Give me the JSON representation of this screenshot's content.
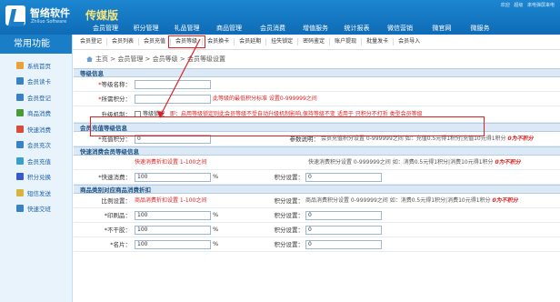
{
  "header": {
    "logo_cn": "智络软件",
    "logo_en": "Zhiluo Software",
    "version": "传媒版",
    "top_links": [
      "欢迎",
      "超级",
      "來电弹屏来电"
    ]
  },
  "main_nav": [
    {
      "label": "会员管理",
      "active": true
    },
    {
      "label": "积分管理",
      "active": false
    },
    {
      "label": "礼品管理",
      "active": false
    },
    {
      "label": "商品管理",
      "active": false
    },
    {
      "label": "会员消费",
      "active": false
    },
    {
      "label": "增值服务",
      "active": false
    },
    {
      "label": "统计报表",
      "active": false
    },
    {
      "label": "微信营销",
      "active": false
    },
    {
      "label": "微官网",
      "active": false
    },
    {
      "label": "微服务",
      "active": false
    }
  ],
  "sub_nav": [
    {
      "label": "会员登记",
      "active": false
    },
    {
      "label": "会员列表",
      "active": false
    },
    {
      "label": "会员充值",
      "active": false
    },
    {
      "label": "会员等级",
      "active": true
    },
    {
      "label": "会员换卡",
      "active": false
    },
    {
      "label": "会员延期",
      "active": false
    },
    {
      "label": "挂失锁定",
      "active": false
    },
    {
      "label": "密码鉴定",
      "active": false
    },
    {
      "label": "账户提现",
      "active": false
    },
    {
      "label": "批量发卡",
      "active": false
    },
    {
      "label": "会员导入",
      "active": false
    }
  ],
  "sidebar": {
    "title": "常用功能",
    "items": [
      {
        "label": "系统首页",
        "icon": "home-icon",
        "color": "#e8a23a"
      },
      {
        "label": "会员读卡",
        "icon": "read-card-icon",
        "color": "#3a82c8"
      },
      {
        "label": "会员登记",
        "icon": "register-icon",
        "color": "#3a82c8"
      },
      {
        "label": "商品消费",
        "icon": "cart-icon",
        "color": "#4a9a3a"
      },
      {
        "label": "快速消费",
        "icon": "quick-consume-icon",
        "color": "#d84a3a"
      },
      {
        "label": "会员充次",
        "icon": "recharge-times-icon",
        "color": "#3a82c8"
      },
      {
        "label": "会员充值",
        "icon": "recharge-icon",
        "color": "#3aa0c8"
      },
      {
        "label": "积分兑换",
        "icon": "points-exchange-icon",
        "color": "#3a5ac8"
      },
      {
        "label": "短信发送",
        "icon": "sms-icon",
        "color": "#d8b43a"
      },
      {
        "label": "快速交班",
        "icon": "handover-icon",
        "color": "#3a82c8"
      }
    ]
  },
  "breadcrumb": "主页 > 会员管理 > 会员等级 > 会员等级设置",
  "sections": {
    "level_info": "等级信息",
    "member_recharge": "会员充值等级信息",
    "quick_consume": "快速消费会员等级信息",
    "product_discount": "商品类别对应商品消费折扣"
  },
  "form": {
    "level_name": {
      "label": "等级名称：",
      "value": ""
    },
    "required_points": {
      "label": "所需积分：",
      "value": "",
      "hint": "此等级的最低积分标准 设置0-999999之间"
    },
    "upgrade_mechanism": {
      "label": "升级机制：",
      "checkbox_label": "等级锁定",
      "hint": "即：启用等级锁定则此会员等级不受自动升级机制影响,保持等级不变 适用于 只积分不打折 类型会员等级"
    },
    "recharge_points": {
      "label": "*充值积分：",
      "value": "0"
    },
    "param_desc": {
      "label": "参数说明：",
      "text": "会员充值积分设置 0-999999之间 如：充值0.5元得1积分|充值10元得1积分",
      "emph": "0为不积分"
    },
    "quick_discount_hint": "快速消费折扣设置 1-100之间",
    "quick_points_hint": "快速消费积分设置 0-999999之间 如：消费0.5元得1积分|消费10元得1积分",
    "quick_points_emph": "0为不积分",
    "quick_consume": {
      "label": "*快速消费：",
      "value": "100",
      "unit": "%"
    },
    "quick_points": {
      "label": "积分设置：",
      "value": "0"
    },
    "ratio": {
      "label": "比例设置：",
      "hint": "商品消费折扣设置 1-100之间"
    },
    "ratio_points": {
      "label": "积分设置：",
      "hint": "商品消费积分设置 0-999999之间 如：消费0.5元得1积分|消费10元得1积分",
      "emph": "0为不积分"
    },
    "print_product": {
      "label": "*印刷品：",
      "value": "100",
      "unit": "%",
      "points_label": "积分设置：",
      "points_value": "0"
    },
    "no_dry": {
      "label": "*不干胶：",
      "value": "100",
      "unit": "%",
      "points_label": "积分设置：",
      "points_value": "0"
    },
    "business_card": {
      "label": "*名片：",
      "value": "100",
      "unit": "%",
      "points_label": "积分设置：",
      "points_value": "0"
    }
  }
}
